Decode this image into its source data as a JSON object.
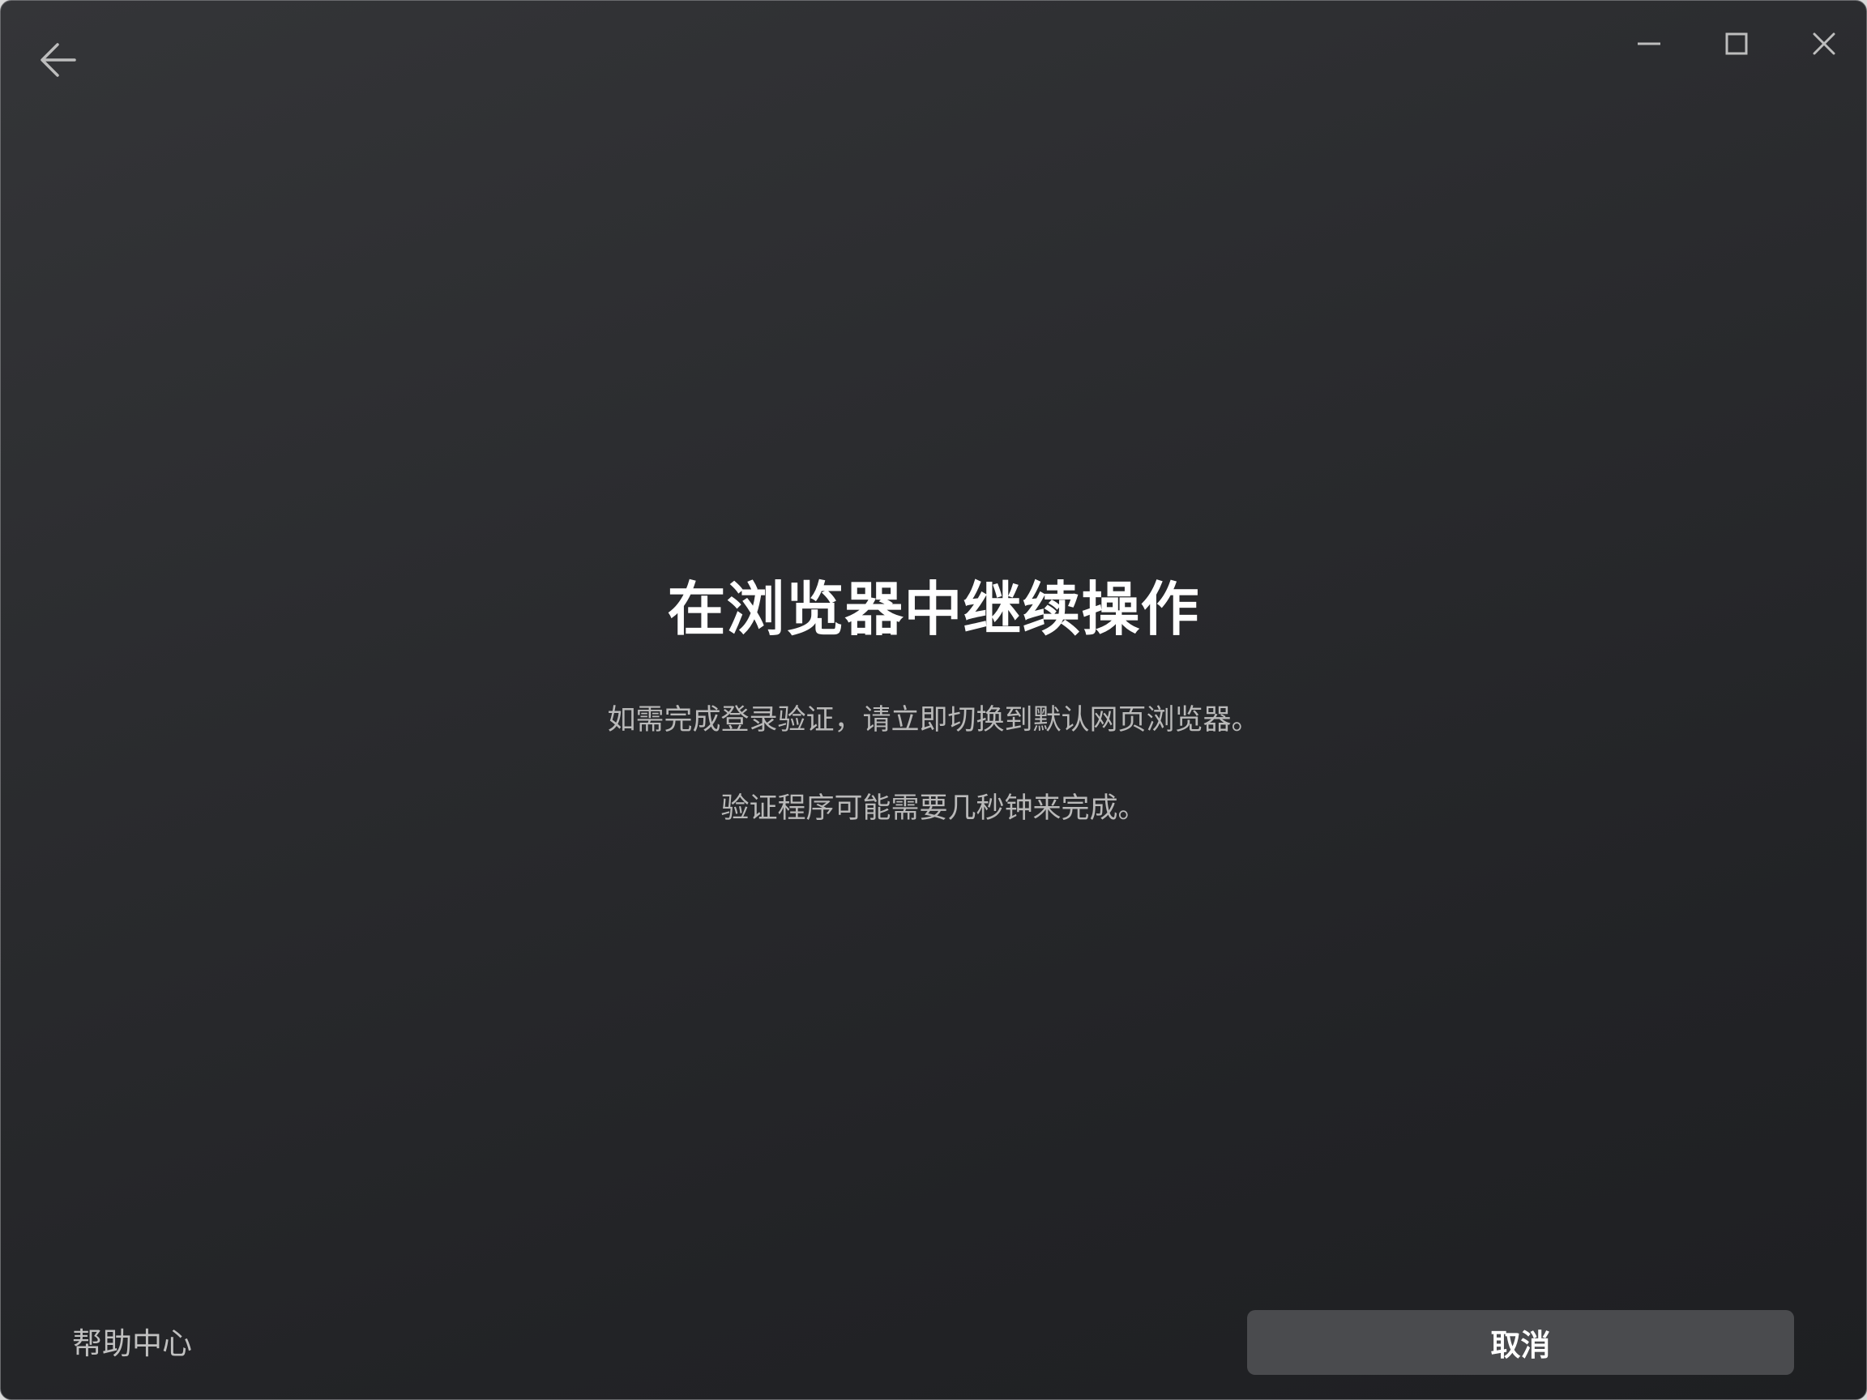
{
  "titlebar": {
    "back_icon": "arrow-left-icon",
    "minimize_icon": "minimize-icon",
    "maximize_icon": "maximize-icon",
    "close_icon": "close-icon"
  },
  "main": {
    "heading": "在浏览器中继续操作",
    "message": "如需完成登录验证，请立即切换到默认网页浏览器。",
    "note": "验证程序可能需要几秒钟来完成。"
  },
  "footer": {
    "help_link": "帮助中心",
    "cancel_label": "取消"
  },
  "colors": {
    "background_top": "#343538",
    "background_bottom": "#1e1f22",
    "heading_text": "#ffffff",
    "body_text": "#b9b9b9",
    "button_background": "#4a4b4e",
    "icon_stroke": "#bdbdbd"
  }
}
